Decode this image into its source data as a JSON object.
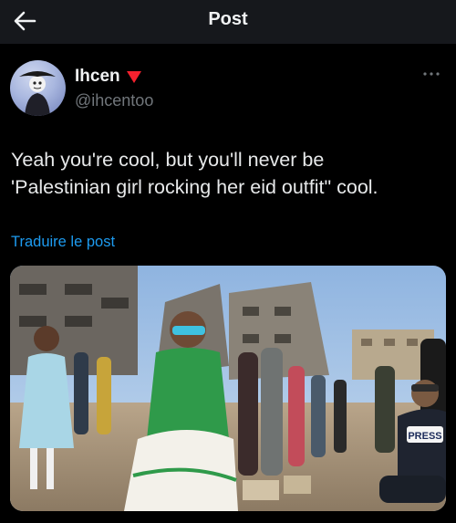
{
  "header": {
    "title": "Post",
    "back_icon": "arrow-left-icon"
  },
  "author": {
    "display_name": "Ihcen",
    "handle": "@ihcentoo",
    "badge_icon": "red-triangle-icon",
    "more_icon": "more-horizontal-icon"
  },
  "post": {
    "text": "Yeah you're cool, but you'll never be\n'Palestinian girl rocking her eid outfit\" cool.",
    "translate_label": "Traduire le post",
    "media_overlay_text": "PRESS"
  },
  "colors": {
    "background": "#000000",
    "header": "#16181c",
    "link": "#1d9bf0",
    "secondary_text": "#71767b",
    "badge": "#f4212e"
  }
}
